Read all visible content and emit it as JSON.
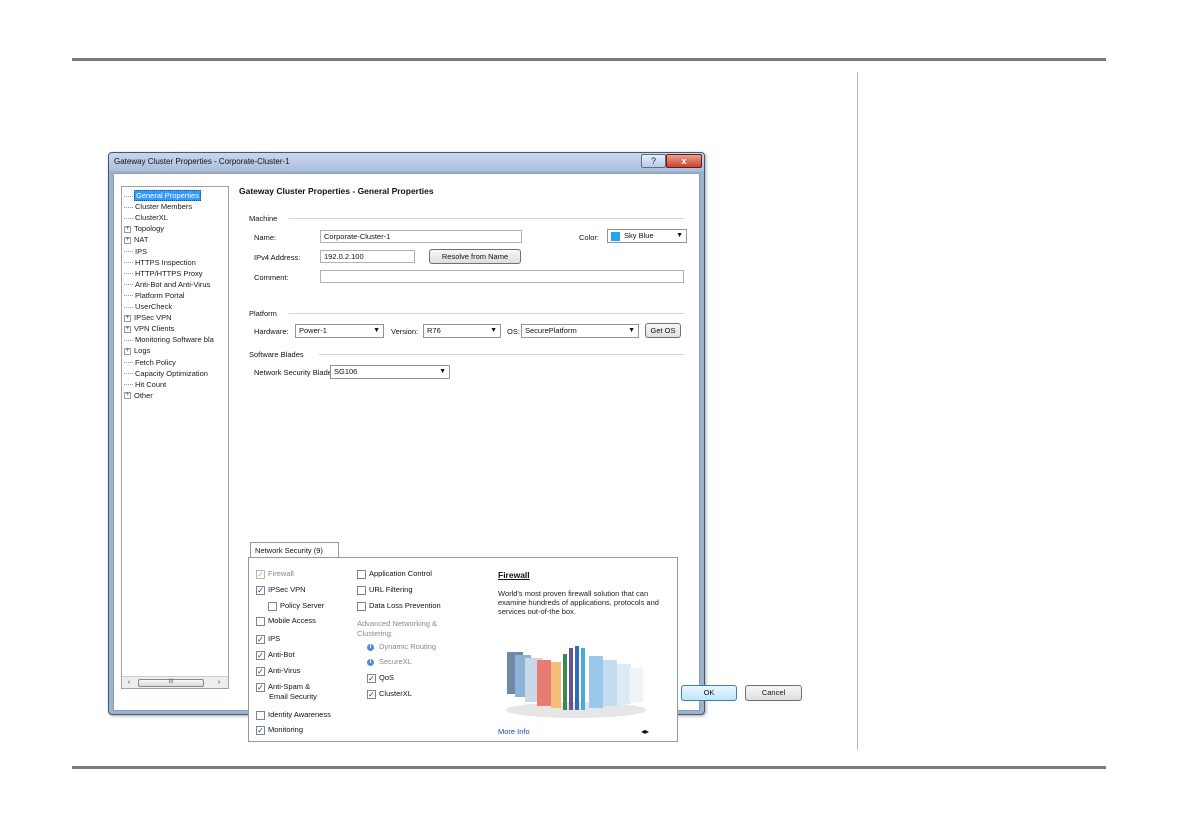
{
  "window": {
    "title": "Gateway Cluster Properties - Corporate-Cluster-1",
    "help_glyph": "?",
    "close_glyph": "x"
  },
  "tree": {
    "items": [
      {
        "label": "General Properties",
        "expander": ""
      },
      {
        "label": "Cluster Members",
        "expander": ""
      },
      {
        "label": "ClusterXL",
        "expander": ""
      },
      {
        "label": "Topology",
        "expander": "+"
      },
      {
        "label": "NAT",
        "expander": "+"
      },
      {
        "label": "IPS",
        "expander": ""
      },
      {
        "label": "HTTPS Inspection",
        "expander": ""
      },
      {
        "label": "HTTP/HTTPS Proxy",
        "expander": ""
      },
      {
        "label": "Anti-Bot and Anti-Virus",
        "expander": ""
      },
      {
        "label": "Platform Portal",
        "expander": ""
      },
      {
        "label": "UserCheck",
        "expander": ""
      },
      {
        "label": "IPSec VPN",
        "expander": "+"
      },
      {
        "label": "VPN Clients",
        "expander": "+"
      },
      {
        "label": "Monitoring Software bla",
        "expander": ""
      },
      {
        "label": "Logs",
        "expander": "+"
      },
      {
        "label": "Fetch Policy",
        "expander": ""
      },
      {
        "label": "Capacity Optimization",
        "expander": ""
      },
      {
        "label": "Hit Count",
        "expander": ""
      },
      {
        "label": "Other",
        "expander": "+"
      }
    ],
    "selected": "General Properties",
    "scroll_left": "‹",
    "scroll_right": "›",
    "scroll_thumb": "III"
  },
  "main": {
    "title": "Gateway Cluster Properties - General Properties",
    "machine": {
      "group_label": "Machine",
      "name_label": "Name:",
      "name_value": "Corporate-Cluster-1",
      "color_label": "Color:",
      "color_value": "Sky Blue",
      "color_hex": "#1ea6ef",
      "ipv4_label": "IPv4 Address:",
      "ipv4_value": "192.0.2.100",
      "resolve_button": "Resolve from Name",
      "comment_label": "Comment:",
      "comment_value": ""
    },
    "platform": {
      "group_label": "Platform",
      "hardware_label": "Hardware:",
      "hardware_value": "Power-1",
      "version_label": "Version:",
      "version_value": "R76",
      "os_label": "OS:",
      "os_value": "SecurePlatform",
      "get_os_button": "Get OS"
    },
    "blades": {
      "group_label": "Software Blades",
      "nsb_label": "Network Security Blades:",
      "nsb_value": "SG106"
    },
    "tab_label": "Network Security (9)",
    "checkboxes_left": [
      {
        "label": "Firewall",
        "checked": true,
        "disabled": true
      },
      {
        "label": "IPSec VPN",
        "checked": true,
        "disabled": false
      },
      {
        "label": "Policy Server",
        "checked": false,
        "disabled": false
      },
      {
        "label": "Mobile Access",
        "checked": false,
        "disabled": false
      },
      {
        "label": "IPS",
        "checked": true,
        "disabled": false
      },
      {
        "label": "Anti-Bot",
        "checked": true,
        "disabled": false
      },
      {
        "label": "Anti-Virus",
        "checked": true,
        "disabled": false
      },
      {
        "label": "Anti-Spam &",
        "label2": "Email Security",
        "checked": true,
        "disabled": false
      },
      {
        "label": "Identity Awareness",
        "checked": false,
        "disabled": false
      },
      {
        "label": "Monitoring",
        "checked": true,
        "disabled": false
      }
    ],
    "checkboxes_right": [
      {
        "label": "Application Control",
        "checked": false
      },
      {
        "label": "URL Filtering",
        "checked": false
      },
      {
        "label": "Data Loss Prevention",
        "checked": false
      }
    ],
    "adv_label_1": "Advanced Networking &",
    "adv_label_2": "Clustering:",
    "info_items": [
      {
        "label": "Dynamic Routing"
      },
      {
        "label": "SecureXL"
      }
    ],
    "checkboxes_adv": [
      {
        "label": "QoS",
        "checked": true
      },
      {
        "label": "ClusterXL",
        "checked": true
      }
    ],
    "blade_info": {
      "title": "Firewall",
      "description": "World's most proven firewall solution that can examine hundreds of applications, protocols and services out-of-the box.",
      "more_info": "More Info",
      "nav": "◂▸"
    },
    "ok_button": "OK",
    "cancel_button": "Cancel"
  }
}
